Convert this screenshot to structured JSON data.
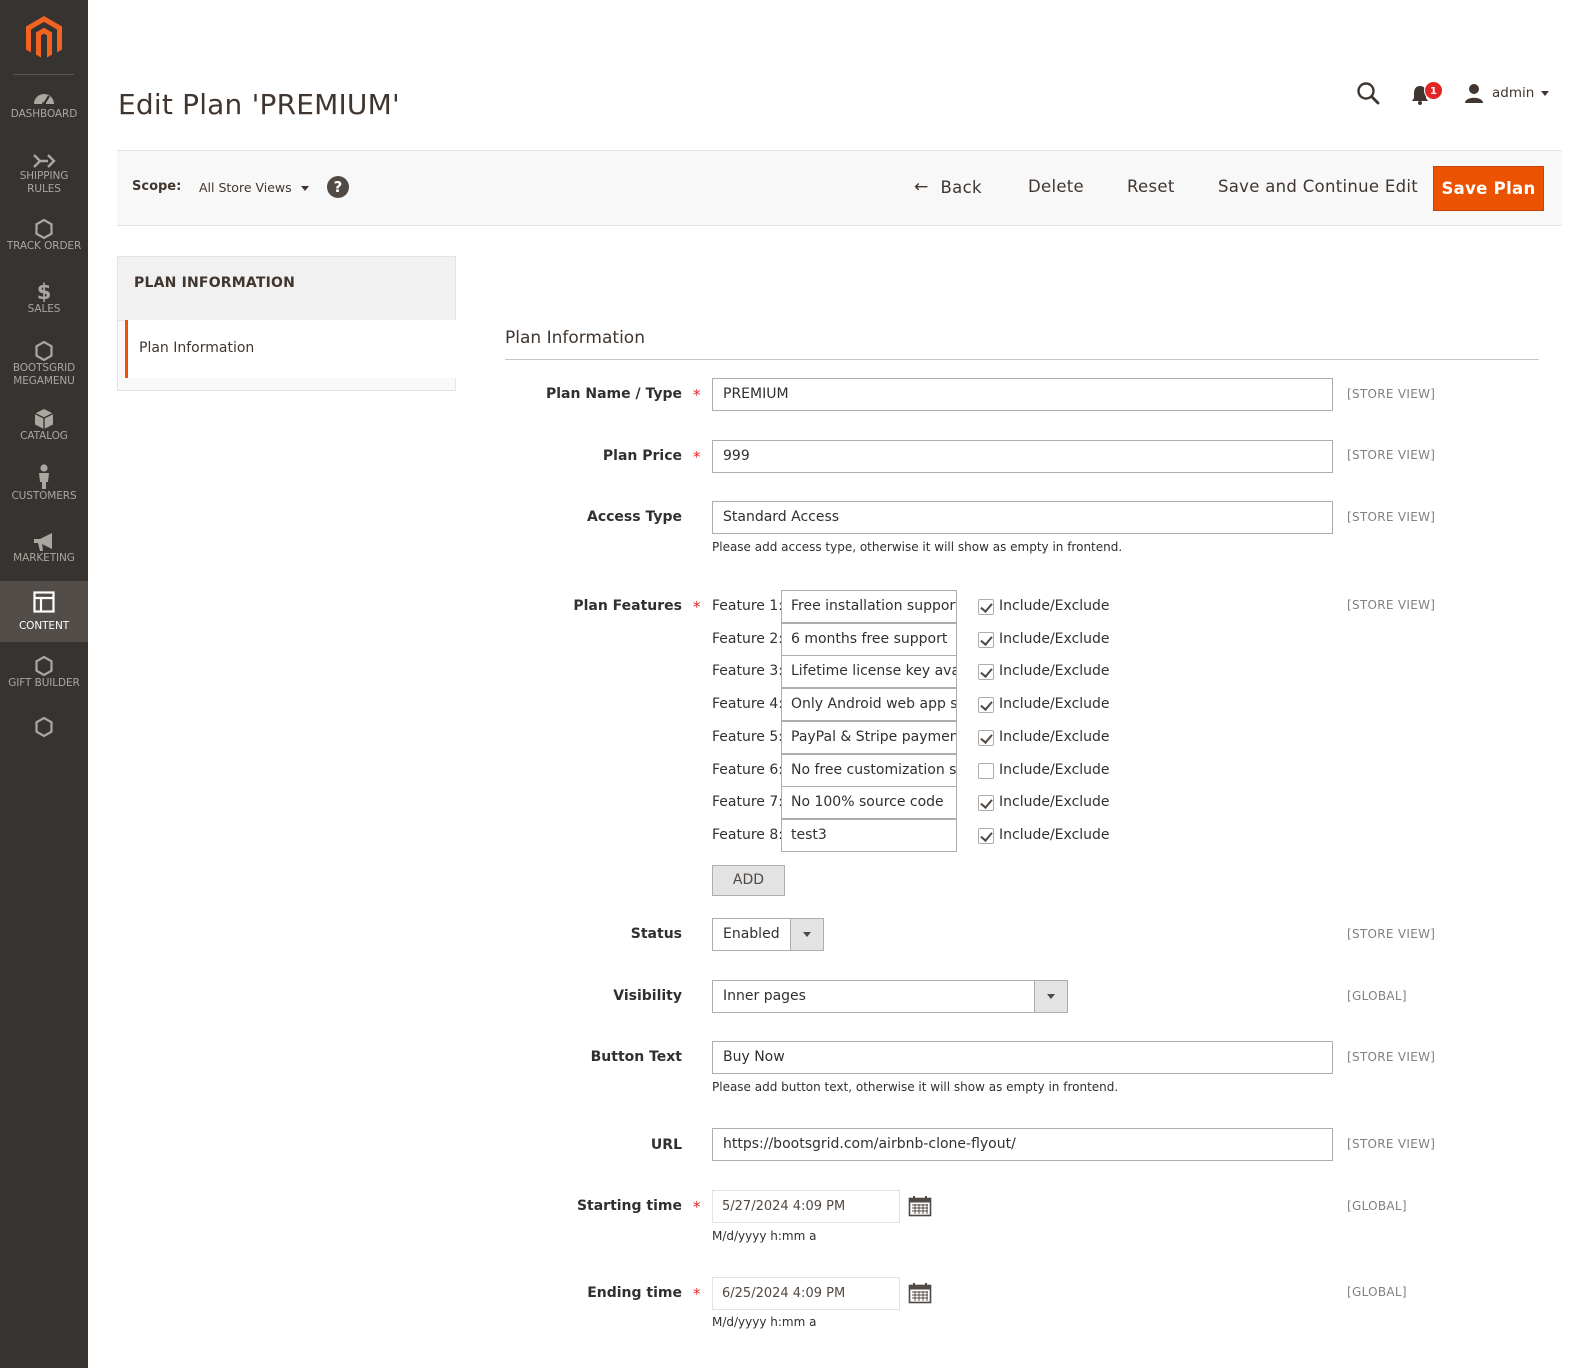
{
  "sidebar": {
    "logo": "magento-logo",
    "items": [
      {
        "label": "DASHBOARD",
        "icon": "dashboard-icon"
      },
      {
        "label": "SHIPPING RULES",
        "icon": "shipping-icon"
      },
      {
        "label": "TRACK ORDER",
        "icon": "hexagon-icon"
      },
      {
        "label": "SALES",
        "icon": "dollar-icon"
      },
      {
        "label": "BOOTSGRID MEGAMENU",
        "icon": "hexagon-icon"
      },
      {
        "label": "CATALOG",
        "icon": "catalog-box-icon"
      },
      {
        "label": "CUSTOMERS",
        "icon": "customer-icon"
      },
      {
        "label": "MARKETING",
        "icon": "megaphone-icon"
      },
      {
        "label": "CONTENT",
        "icon": "content-layout-icon",
        "active": true
      },
      {
        "label": "GIFT BUILDER",
        "icon": "hexagon-icon"
      },
      {
        "label": "",
        "icon": "hexagon-icon"
      }
    ]
  },
  "header": {
    "title": "Edit Plan 'PREMIUM'",
    "notification_count": "1",
    "user": "admin"
  },
  "action_bar": {
    "scope_label": "Scope:",
    "scope_value": "All Store Views",
    "help": "?",
    "back": "Back",
    "delete": "Delete",
    "reset": "Reset",
    "save_continue": "Save and Continue Edit",
    "save": "Save Plan"
  },
  "tabs": {
    "heading": "PLAN INFORMATION",
    "active_tab": "Plan Information"
  },
  "form": {
    "section_title": "Plan Information",
    "plan_name": {
      "label": "Plan Name / Type",
      "value": "PREMIUM",
      "scope": "[STORE VIEW]",
      "required": "*"
    },
    "plan_price": {
      "label": "Plan Price",
      "value": "999",
      "scope": "[STORE VIEW]",
      "required": "*"
    },
    "access_type": {
      "label": "Access Type",
      "value": "Standard Access",
      "scope": "[STORE VIEW]",
      "note": "Please add access type, otherwise it will show as empty in frontend."
    },
    "plan_features": {
      "label": "Plan Features",
      "required": "*",
      "scope": "[STORE VIEW]",
      "check_label": "Include/Exclude",
      "items": [
        {
          "label": "Feature 1:",
          "value": "Free installation support",
          "checked": true
        },
        {
          "label": "Feature 2:",
          "value": "6 months free support",
          "checked": true
        },
        {
          "label": "Feature 3:",
          "value": "Lifetime license key avai",
          "checked": true
        },
        {
          "label": "Feature 4:",
          "value": "Only Android web app s",
          "checked": true
        },
        {
          "label": "Feature 5:",
          "value": "PayPal & Stripe paymen",
          "checked": true
        },
        {
          "label": "Feature 6:",
          "value": "No free customization su",
          "checked": false
        },
        {
          "label": "Feature 7:",
          "value": "No 100% source code",
          "checked": true
        },
        {
          "label": "Feature 8:",
          "value": "test3",
          "checked": true
        }
      ],
      "add_button": "ADD"
    },
    "status": {
      "label": "Status",
      "value": "Enabled",
      "scope": "[STORE VIEW]"
    },
    "visibility": {
      "label": "Visibility",
      "value": "Inner pages",
      "scope": "[GLOBAL]"
    },
    "button_text": {
      "label": "Button Text",
      "value": "Buy Now",
      "scope": "[STORE VIEW]",
      "note": "Please add button text, otherwise it will show as empty in frontend."
    },
    "url": {
      "label": "URL",
      "value": "https://bootsgrid.com/airbnb-clone-flyout/",
      "scope": "[STORE VIEW]"
    },
    "starting_time": {
      "label": "Starting time",
      "value": "5/27/2024 4:09 PM",
      "scope": "[GLOBAL]",
      "note": "M/d/yyyy h:mm a",
      "required": "*"
    },
    "ending_time": {
      "label": "Ending time",
      "value": "6/25/2024 4:09 PM",
      "scope": "[GLOBAL]",
      "note": "M/d/yyyy h:mm a",
      "required": "*"
    }
  },
  "colors": {
    "sidebar_bg": "#373330",
    "accent": "#eb5202",
    "required": "#e22626"
  }
}
